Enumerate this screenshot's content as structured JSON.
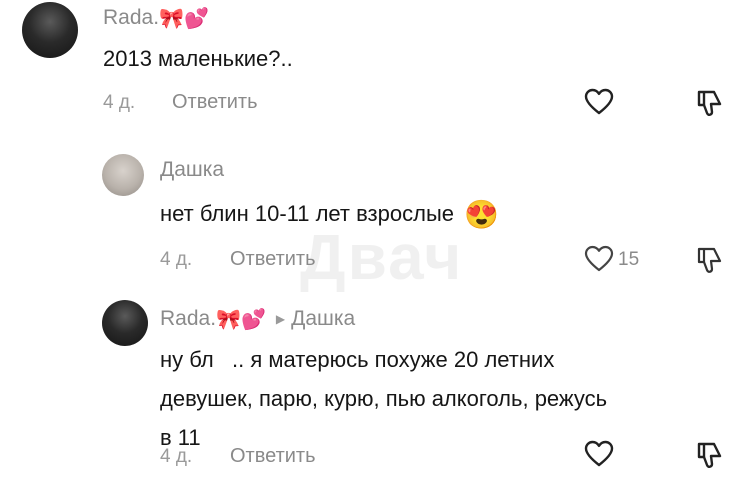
{
  "watermark": "Двач",
  "comments": [
    {
      "username": "Rada.",
      "username_emoji": "🎀💕",
      "text": "2013 маленькие?..",
      "date": "4 д.",
      "reply_label": "Ответить",
      "like_count": ""
    },
    {
      "username": "Дашка",
      "text": "нет блин 10-11 лет взрослые",
      "text_emoji": "😍",
      "date": "4 д.",
      "reply_label": "Ответить",
      "like_count": "15"
    },
    {
      "username": "Rada.",
      "username_emoji": "🎀💕",
      "reply_to": "Дашка",
      "text_line1": "ну бл   .. я матерюсь похуже 20 летних",
      "text_line2": "девушек, парю, курю, пью алкоголь, режусь",
      "text_line3": "в 11",
      "date": "4 д.",
      "reply_label": "Ответить",
      "like_count": ""
    }
  ],
  "colors": {
    "text": "#161616",
    "muted": "#8a8a8a",
    "background": "#ffffff"
  },
  "icons": [
    "heart-outline-icon",
    "dislike-icon",
    "reply-arrow-icon"
  ]
}
